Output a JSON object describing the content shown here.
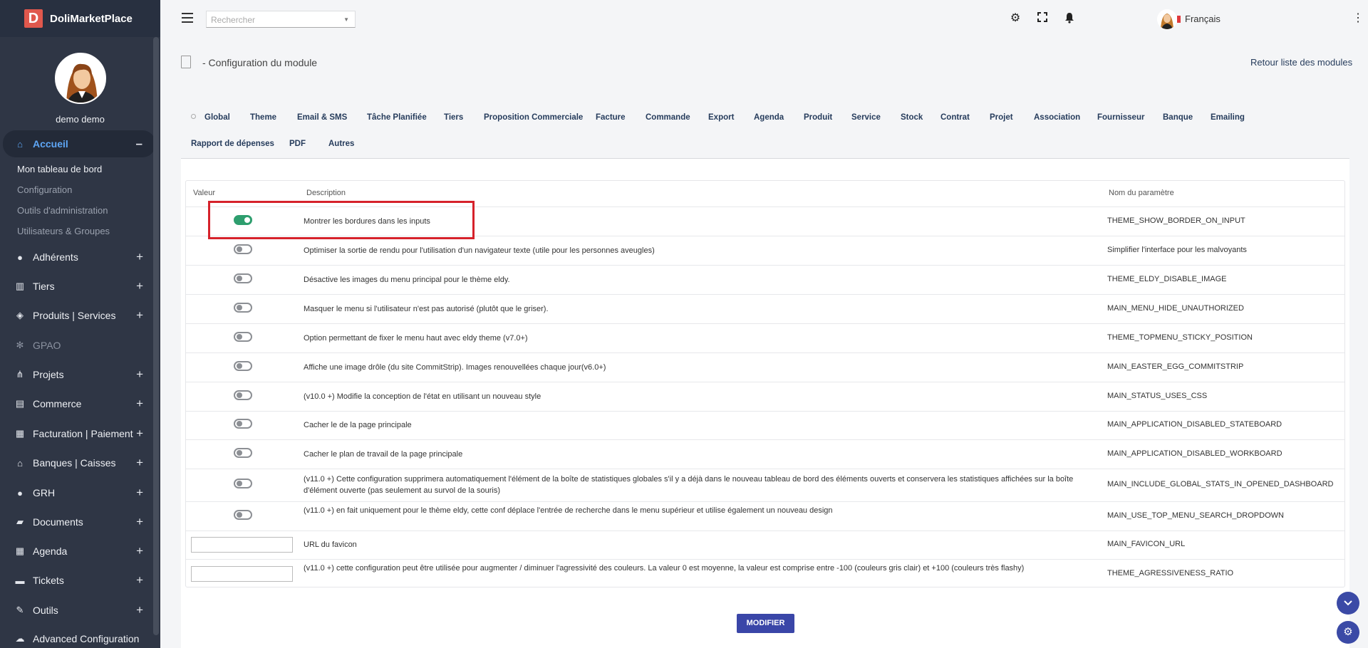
{
  "app": {
    "logo_letter": "D",
    "name": "DoliMarketPlace"
  },
  "user": {
    "name": "demo demo"
  },
  "search": {
    "placeholder": "Rechercher"
  },
  "topbar": {
    "language": "Français"
  },
  "page": {
    "title": "- Configuration du module",
    "back_link": "Retour liste des modules",
    "modify_button": "MODIFIER"
  },
  "menu": [
    {
      "label": "Accueil",
      "icon": "home-icon",
      "expander": "–",
      "active": true
    },
    {
      "label": "Adhérents",
      "icon": "user-icon",
      "expander": "+"
    },
    {
      "label": "Tiers",
      "icon": "building-icon",
      "expander": "+"
    },
    {
      "label": "Produits | Services",
      "icon": "cube-icon",
      "expander": "+"
    },
    {
      "label": "GPAO",
      "icon": "cogs-icon",
      "expander": "",
      "disabled": true
    },
    {
      "label": "Projets",
      "icon": "sitemap-icon",
      "expander": "+"
    },
    {
      "label": "Commerce",
      "icon": "suitcase-icon",
      "expander": "+"
    },
    {
      "label": "Facturation | Paiement",
      "icon": "invoice-icon",
      "expander": "+"
    },
    {
      "label": "Banques | Caisses",
      "icon": "bank-icon",
      "expander": "+"
    },
    {
      "label": "GRH",
      "icon": "user-tie-icon",
      "expander": "+"
    },
    {
      "label": "Documents",
      "icon": "folder-icon",
      "expander": "+"
    },
    {
      "label": "Agenda",
      "icon": "calendar-icon",
      "expander": "+"
    },
    {
      "label": "Tickets",
      "icon": "ticket-icon",
      "expander": "+"
    },
    {
      "label": "Outils",
      "icon": "wrench-icon",
      "expander": "+"
    },
    {
      "label": "Advanced Configuration",
      "icon": "cloud-icon",
      "expander": ""
    }
  ],
  "submenu": [
    "Mon tableau de bord",
    "Configuration",
    "Outils d'administration",
    "Utilisateurs & Groupes"
  ],
  "tabs": [
    "Global",
    "Theme",
    "Email & SMS",
    "Tâche Planifiée",
    "Tiers",
    "Proposition Commerciale",
    "Facture",
    "Commande",
    "Export",
    "Agenda",
    "Produit",
    "Service",
    "Stock",
    "Contrat",
    "Projet",
    "Association",
    "Fournisseur",
    "Banque",
    "Emailing",
    "Rapport de dépenses",
    "PDF",
    "Autres"
  ],
  "table": {
    "headers": {
      "value": "Valeur",
      "description": "Description",
      "param": "Nom du paramètre"
    },
    "rows": [
      {
        "type": "toggle",
        "on": true,
        "description": "Montrer les bordures dans les inputs",
        "param": "THEME_SHOW_BORDER_ON_INPUT"
      },
      {
        "type": "toggle",
        "on": false,
        "description": "Optimiser la sortie de rendu pour l'utilisation d'un navigateur texte (utile pour les personnes aveugles)",
        "param": "Simplifier l'interface pour les malvoyants"
      },
      {
        "type": "toggle",
        "on": false,
        "description": "Désactive les images du menu principal pour le thème eldy.",
        "param": "THEME_ELDY_DISABLE_IMAGE"
      },
      {
        "type": "toggle",
        "on": false,
        "description": "Masquer le menu si l'utilisateur n'est pas autorisé (plutôt que le griser).",
        "param": "MAIN_MENU_HIDE_UNAUTHORIZED"
      },
      {
        "type": "toggle",
        "on": false,
        "description": "Option permettant de fixer le menu haut avec eldy theme (v7.0+)",
        "param": "THEME_TOPMENU_STICKY_POSITION"
      },
      {
        "type": "toggle",
        "on": false,
        "description": "Affiche une image drôle (du site CommitStrip). Images renouvellées chaque jour(v6.0+)",
        "param": "MAIN_EASTER_EGG_COMMITSTRIP"
      },
      {
        "type": "toggle",
        "on": false,
        "description": "(v10.0 +) Modifie la conception de l'état en utilisant un nouveau style",
        "param": "MAIN_STATUS_USES_CSS"
      },
      {
        "type": "toggle",
        "on": false,
        "description": "Cacher le de la page principale",
        "param": "MAIN_APPLICATION_DISABLED_STATEBOARD"
      },
      {
        "type": "toggle",
        "on": false,
        "description": "Cacher le plan de travail de la page principale",
        "param": "MAIN_APPLICATION_DISABLED_WORKBOARD"
      },
      {
        "type": "toggle",
        "on": false,
        "description": "(v11.0 +) Cette configuration supprimera automatiquement l'élément de la boîte de statistiques globales s'il y a déjà dans le nouveau tableau de bord des éléments ouverts et conservera les statistiques affichées sur la boîte d'élément ouverte (pas seulement au survol de la souris)",
        "param": "MAIN_INCLUDE_GLOBAL_STATS_IN_OPENED_DASHBOARD"
      },
      {
        "type": "toggle",
        "on": false,
        "description": "(v11.0 +) en fait uniquement pour le thème eldy, cette conf déplace l'entrée de recherche dans le menu supérieur et utilise également un nouveau design",
        "param": "MAIN_USE_TOP_MENU_SEARCH_DROPDOWN"
      },
      {
        "type": "input",
        "value": "",
        "description": "URL du favicon",
        "param": "MAIN_FAVICON_URL"
      },
      {
        "type": "input",
        "value": "",
        "description": "(v11.0 +) cette configuration peut être utilisée pour augmenter / diminuer l'agressivité des couleurs. La valeur 0 est moyenne, la valeur est comprise entre -100 (couleurs gris clair) et +100 (couleurs très flashy)",
        "param": "THEME_AGRESSIVENESS_RATIO"
      }
    ]
  },
  "colors": {
    "sidebar": "#2f3645",
    "accent": "#3a46a8",
    "toggle_on": "#2e9e6e",
    "highlight": "#d6222b",
    "active_menu": "#5ea6f5"
  }
}
